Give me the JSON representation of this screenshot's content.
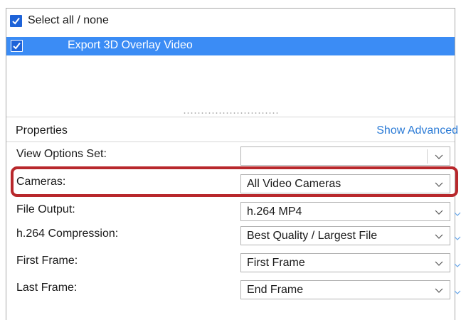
{
  "task_list": {
    "select_all_label": "Select all / none",
    "select_all_checked": true,
    "items": [
      {
        "label": "Export 3D Overlay Video",
        "checked": true,
        "selected": true
      }
    ]
  },
  "properties": {
    "title": "Properties",
    "show_advanced_label": "Show Advanced",
    "rows": [
      {
        "label": "View Options Set:",
        "value": ""
      },
      {
        "label": "Cameras:",
        "value": "All Video Cameras"
      },
      {
        "label": "File Output:",
        "value": "h.264 MP4"
      },
      {
        "label": "h.264 Compression:",
        "value": "Best Quality / Largest File"
      },
      {
        "label": "First Frame:",
        "value": "First Frame"
      },
      {
        "label": "Last Frame:",
        "value": "End Frame"
      }
    ]
  },
  "icons": {
    "checkmark": "checkmark-icon",
    "dropdown": "chevron-down-icon"
  },
  "colors": {
    "accent_blue": "#1e63d8",
    "selection_blue": "#3b8cf5",
    "link_blue": "#2b7bd6",
    "highlight_red": "#b8282c"
  }
}
